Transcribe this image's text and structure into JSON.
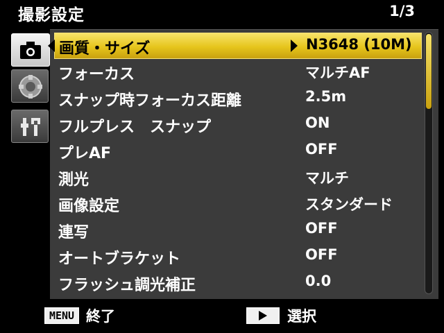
{
  "header": {
    "title": "撮影設定",
    "page": "1/3"
  },
  "tabs": [
    {
      "name": "camera",
      "icon": "camera-icon",
      "active": true
    },
    {
      "name": "scene",
      "icon": "dial-icon",
      "active": false
    },
    {
      "name": "setup",
      "icon": "wrench-icon",
      "active": false
    }
  ],
  "menu": {
    "items": [
      {
        "label": "画質・サイズ",
        "value": "N3648 (10M)",
        "selected": true
      },
      {
        "label": "フォーカス",
        "value": "マルチAF"
      },
      {
        "label": "スナップ時フォーカス距離",
        "value": "2.5m"
      },
      {
        "label": "フルプレス　スナップ",
        "value": "ON"
      },
      {
        "label": "プレAF",
        "value": "OFF"
      },
      {
        "label": "測光",
        "value": "マルチ"
      },
      {
        "label": "画像設定",
        "value": "スタンダード"
      },
      {
        "label": "連写",
        "value": "OFF"
      },
      {
        "label": "オートブラケット",
        "value": "OFF"
      },
      {
        "label": "フラッシュ調光補正",
        "value": "0.0"
      }
    ]
  },
  "scroll": {
    "position_fraction": 0.0,
    "visible_fraction": 0.29
  },
  "footer": {
    "menu_key": "MENU",
    "exit_label": "終了",
    "select_label": "選択"
  },
  "colors": {
    "highlight": "#e6c51c",
    "panel": "#3b3b3b"
  }
}
